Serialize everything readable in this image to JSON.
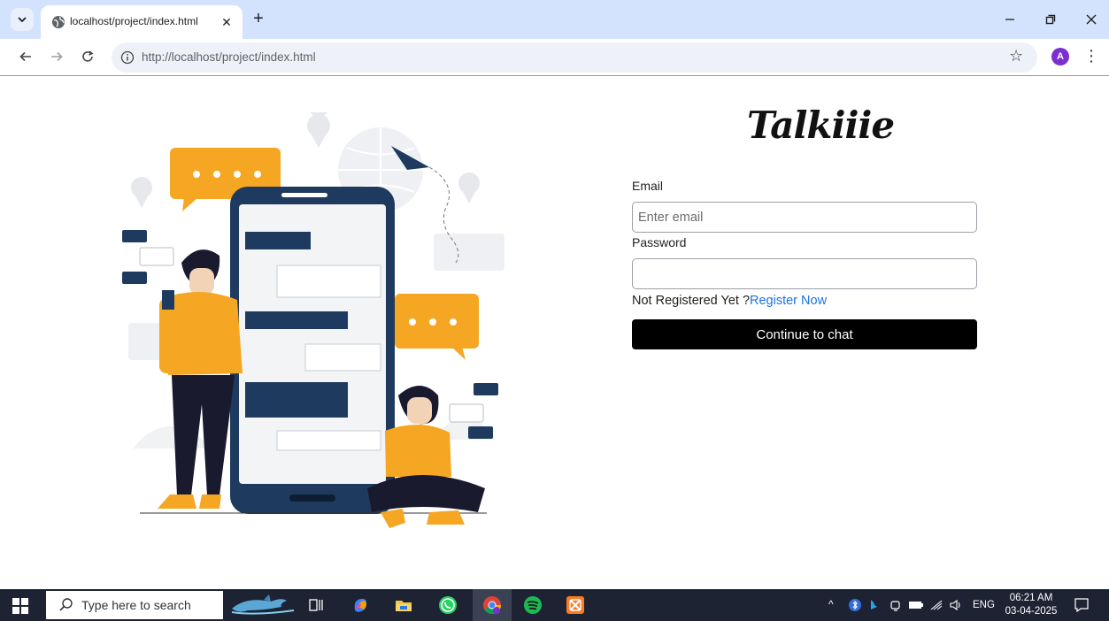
{
  "browser": {
    "tab_title": "localhost/project/index.html",
    "url_host": "http://localhost",
    "url_path": "/project/index.html",
    "profile_initial": "A"
  },
  "page": {
    "brand": "Talkiiie",
    "email_label": "Email",
    "email_placeholder": "Enter email",
    "email_value": "",
    "password_label": "Password",
    "password_value": "",
    "register_prompt": "Not Registered Yet ?",
    "register_link": "Register Now",
    "submit_label": "Continue to chat",
    "colors": {
      "accent": "#f5a623",
      "navy": "#1e3a5f",
      "link": "#1a73e8",
      "button": "#000000"
    }
  },
  "taskbar": {
    "search_placeholder": "Type here to search",
    "language": "ENG",
    "time": "06:21 AM",
    "date": "03-04-2025",
    "apps": [
      "task-view-icon",
      "copilot-icon",
      "file-explorer-icon",
      "whatsapp-icon",
      "chrome-icon",
      "spotify-icon",
      "xampp-icon"
    ]
  }
}
